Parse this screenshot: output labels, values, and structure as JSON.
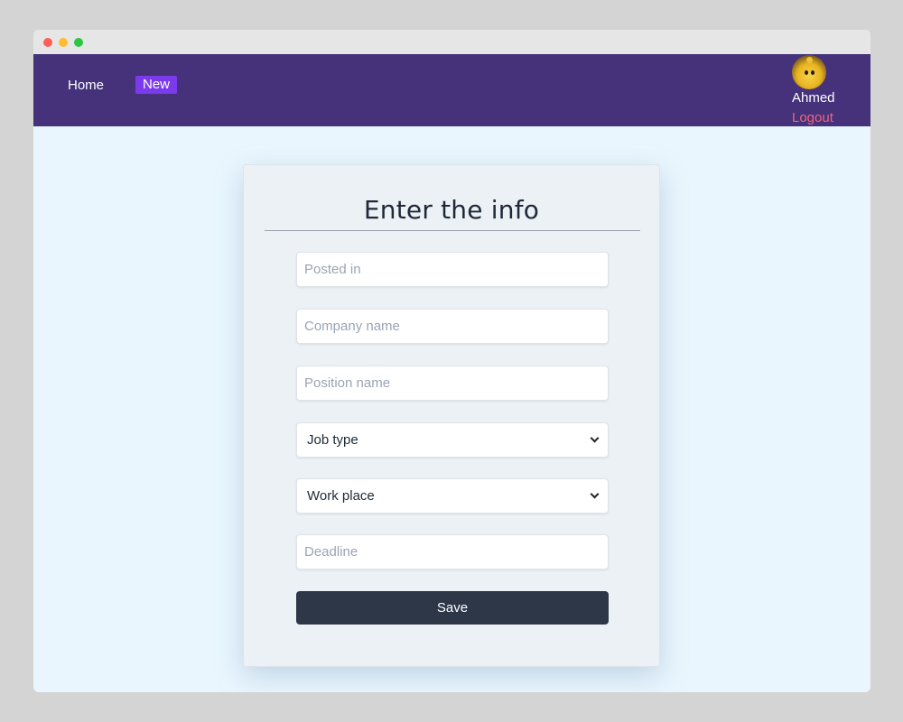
{
  "window": {
    "controls": [
      "close",
      "minimize",
      "maximize"
    ]
  },
  "nav": {
    "home_label": "Home",
    "new_label": "New",
    "user_name": "Ahmed",
    "logout_label": "Logout",
    "avatar_icon": "chick-avatar"
  },
  "form": {
    "title": "Enter the info",
    "posted_in_placeholder": "Posted in",
    "company_placeholder": "Company name",
    "position_placeholder": "Position name",
    "job_type_selected": "Job type",
    "work_place_selected": "Work place",
    "deadline_placeholder": "Deadline",
    "save_label": "Save"
  },
  "colors": {
    "navbar": "#45327b",
    "new_badge": "#7c3aed",
    "logout": "#f0627a",
    "save_button": "#2d3748",
    "page_bg": "#e9f6fe"
  }
}
